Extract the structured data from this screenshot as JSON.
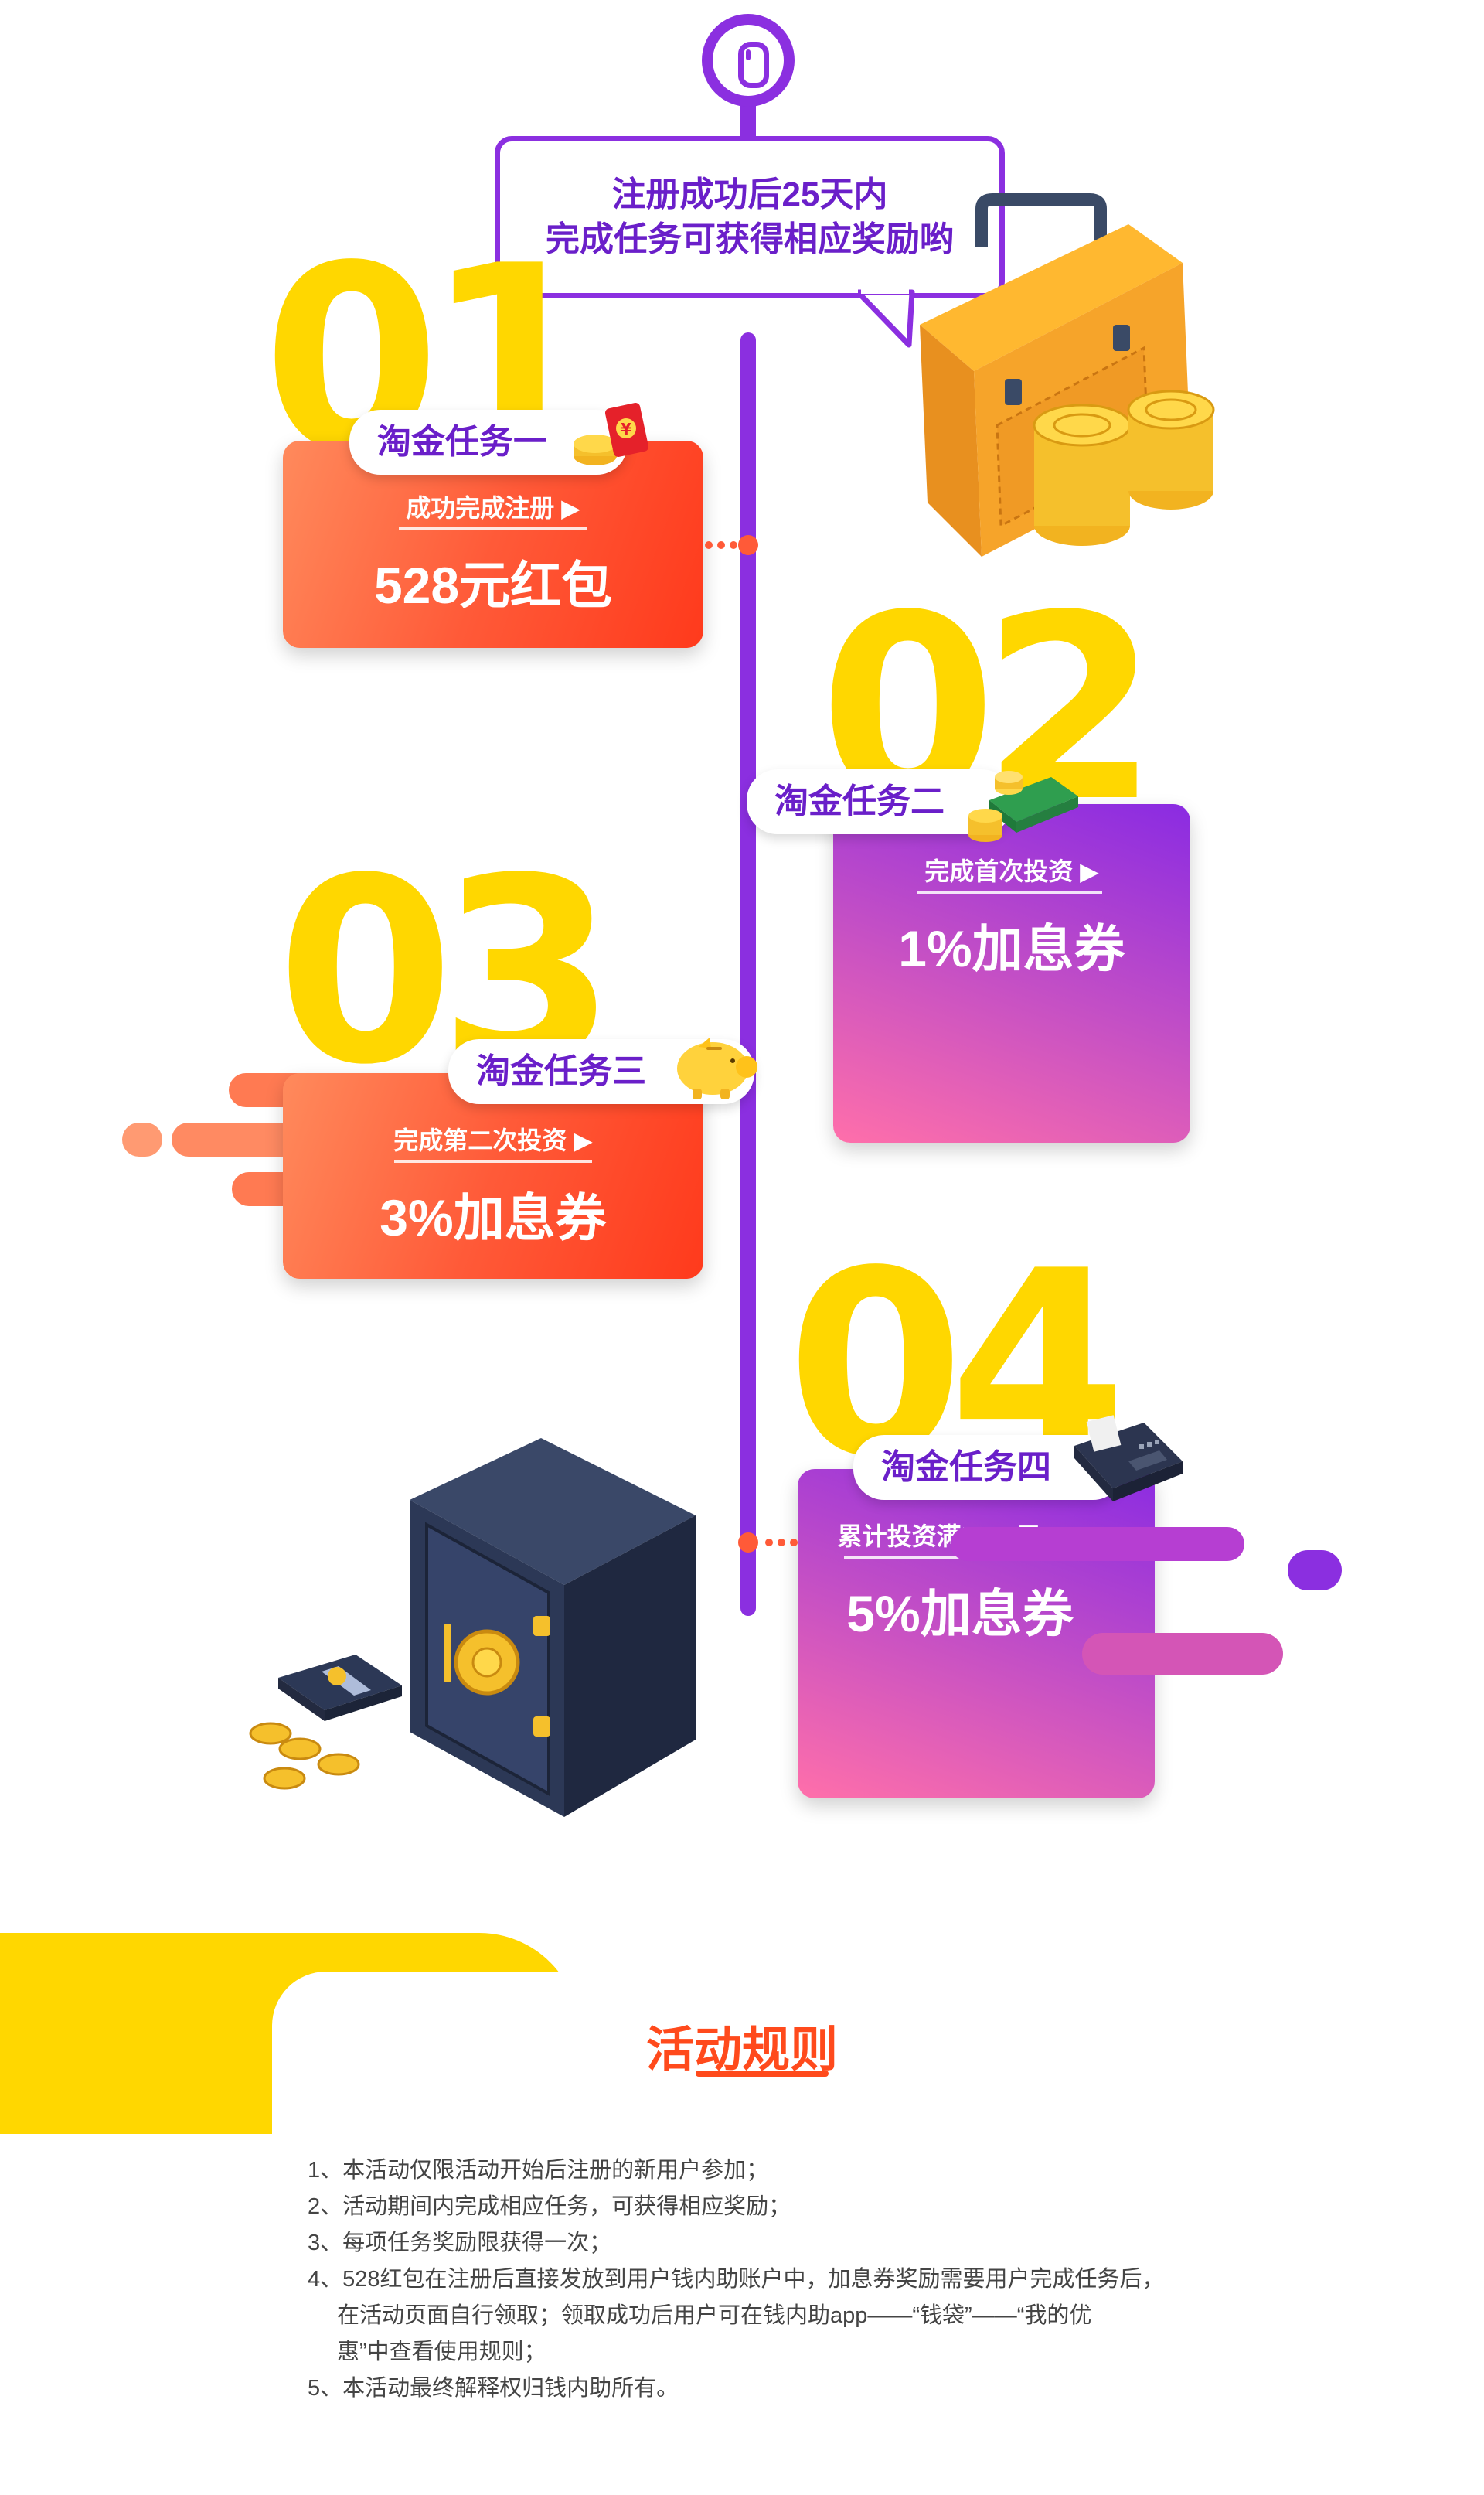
{
  "header": {
    "line1": "注册成功后25天内",
    "line2": "完成任务可获得相应奖励哟"
  },
  "tasks": [
    {
      "num": "01",
      "name": "淘金任务一",
      "condition": "成功完成注册",
      "reward": "528元红包"
    },
    {
      "num": "02",
      "name": "淘金任务二",
      "condition": "完成首次投资",
      "reward": "1%加息券"
    },
    {
      "num": "03",
      "name": "淘金任务三",
      "condition": "完成第二次投资",
      "reward": "3%加息券"
    },
    {
      "num": "04",
      "name": "淘金任务四",
      "condition": "累计投资满5000元",
      "reward": "5%加息券"
    }
  ],
  "arrow": "▶",
  "rules": {
    "title": "活动规则",
    "items": [
      "1、本活动仅限活动开始后注册的新用户参加；",
      "2、活动期间内完成相应任务，可获得相应奖励；",
      "3、每项任务奖励限获得一次；",
      "4、528红包在注册后直接发放到用户钱内助账户中，加息券奖励需要用户完成任务后，",
      "在活动页面自行领取；领取成功后用户可在钱内助app——“钱袋”——“我的优",
      "惠”中查看使用规则；",
      "5、本活动最终解释权归钱内助所有。"
    ]
  },
  "colors": {
    "purple": "#8b2fe0",
    "yellow": "#ffd700",
    "orange": "#ff5a38",
    "pink": "#ff6faa"
  },
  "icons": [
    "mouse-icon",
    "briefcase-illustration",
    "coin-stack-icon",
    "red-envelope-icon",
    "cash-bundle-icon",
    "piggy-bank-icon",
    "pos-terminal-icon",
    "safe-illustration"
  ]
}
